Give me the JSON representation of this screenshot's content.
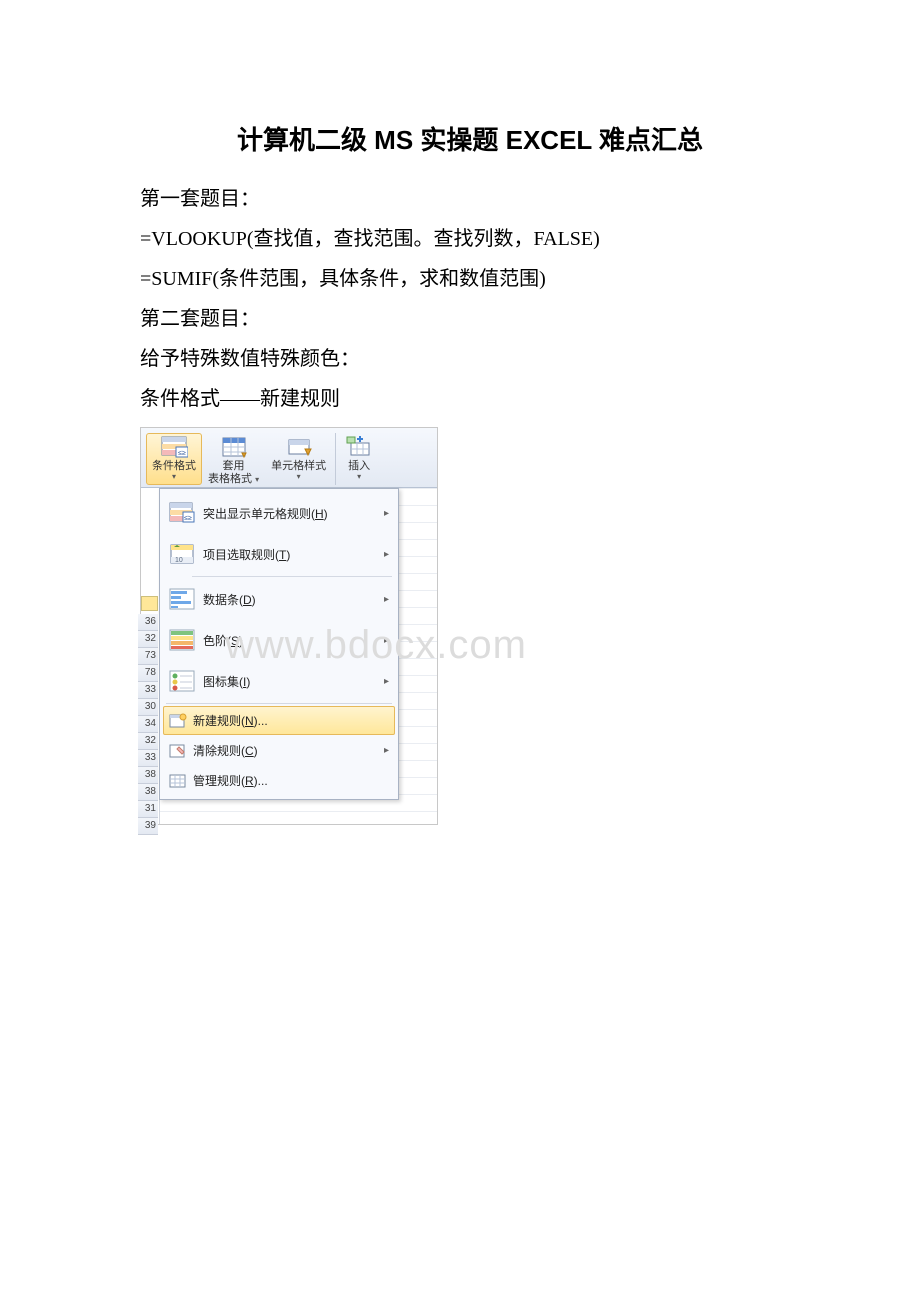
{
  "title": "计算机二级 MS 实操题 EXCEL 难点汇总",
  "lines": {
    "l1": "第一套题目：",
    "l2": "=VLOOKUP(查找值，查找范围。查找列数，FALSE)",
    "l3": "=SUMIF(条件范围，具体条件，求和数值范围)",
    "l4": "第二套题目：",
    "l5": "给予特殊数值特殊颜色：",
    "l6": "条件格式——新建规则"
  },
  "ribbon": {
    "cond_fmt": "条件格式",
    "table_fmt_l1": "套用",
    "table_fmt_l2": "表格格式",
    "cell_style": "单元格样式",
    "insert": "插入"
  },
  "menu": {
    "highlight": "突出显示单元格规则(H)",
    "toprules": "项目选取规则(T)",
    "databar": "数据条(D)",
    "colorscale": "色阶(S)",
    "iconset": "图标集(I)",
    "newrule": "新建规则(N)...",
    "clear": "清除规则(C)",
    "manage": "管理规则(R)..."
  },
  "rowheaders": [
    "36",
    "32",
    "73",
    "78",
    "33",
    "30",
    "34",
    "32",
    "33",
    "38",
    "38",
    "31",
    "39"
  ],
  "watermark": "www.bdocx.com"
}
